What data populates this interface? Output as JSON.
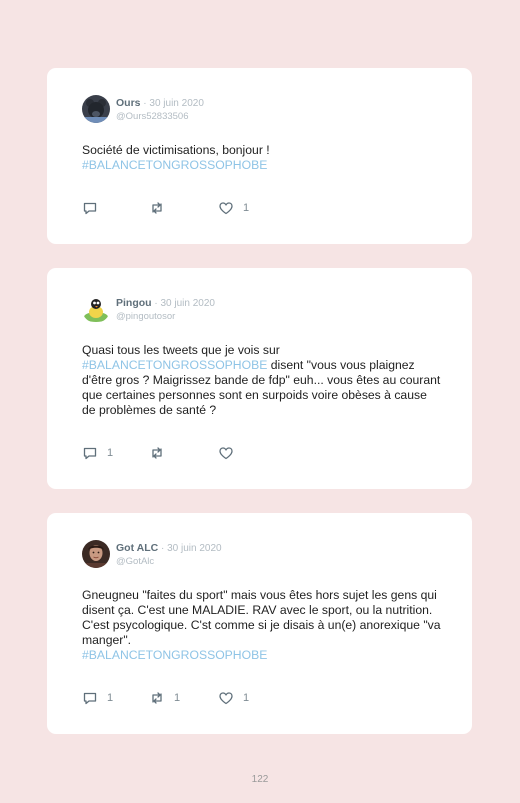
{
  "tweets": [
    {
      "name": "Ours",
      "date": " · 30 juin 2020",
      "handle": "@Ours52833506",
      "text": "Société de victimisations, bonjour !",
      "hashtag": "#BALANCETONGROSSOPHOBE",
      "replies": "",
      "retweets": "",
      "likes": "1",
      "avatar_icon": "bear-avatar-icon"
    },
    {
      "name": "Pingou",
      "date": " · 30 juin 2020",
      "handle": "@pingoutosor",
      "text_before": "Quasi tous les tweets que je vois sur",
      "hashtag": "#BALANCETONGROSSOPHOBE",
      "text_after": " disent \"vous vous plaignez d'être gros ? Maigrissez bande de fdp\" euh... vous êtes au courant que certaines personnes sont en surpoids voire obèses à cause de problèmes de santé ?",
      "replies": "1",
      "retweets": "",
      "likes": "",
      "avatar_icon": "penguin-avatar-icon"
    },
    {
      "name": "Got ALC",
      "date": " · 30 juin 2020",
      "handle": "@GotAlc",
      "text": "Gneugneu \"faites du sport\" mais vous êtes hors sujet les gens qui disent ça. C'est une MALADIE. RAV avec le sport, ou la nutrition. C'est psycologique. C'st comme si je disais à un(e) anorexique \"va manger\".",
      "hashtag": "#BALANCETONGROSSOPHOBE",
      "replies": "1",
      "retweets": "1",
      "likes": "1",
      "avatar_icon": "portrait-avatar-icon"
    }
  ],
  "page_number": "122",
  "colors": {
    "background": "#f6e4e4",
    "card": "#ffffff",
    "hashtag": "#8fc4e6",
    "name": "#5f6f7a",
    "muted": "#b3bcc3"
  }
}
